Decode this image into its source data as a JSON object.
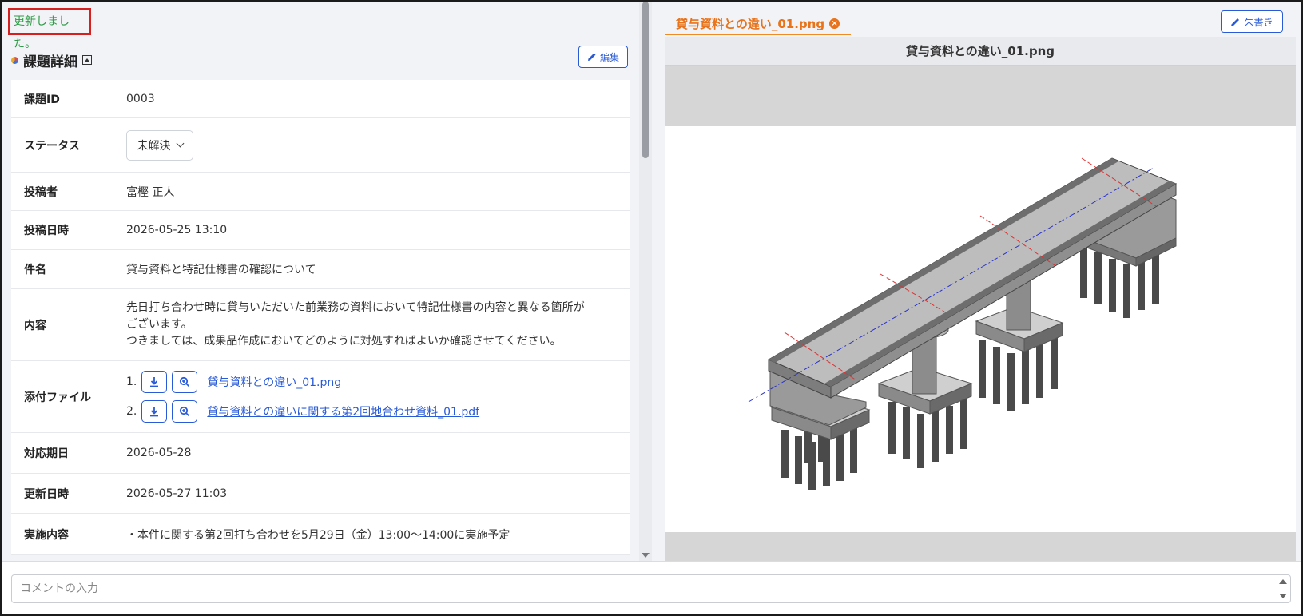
{
  "flash_message": "更新しました。",
  "section": {
    "title": "課題詳細",
    "edit_label": "編集"
  },
  "fields": {
    "issue_id": {
      "label": "課題ID",
      "value": "0003"
    },
    "status": {
      "label": "ステータス",
      "value": "未解決"
    },
    "poster": {
      "label": "投稿者",
      "value": "富樫 正人"
    },
    "posted_at": {
      "label": "投稿日時",
      "value": "2026-05-25 13:10"
    },
    "subject": {
      "label": "件名",
      "value": "貸与資料と特記仕様書の確認について"
    },
    "content": {
      "label": "内容",
      "lines": [
        "先日打ち合わせ時に貸与いただいた前業務の資料において特記仕様書の内容と異なる箇所が",
        "ございます。",
        "つきましては、成果品作成においてどのように対処すればよいか確認させてください。"
      ]
    },
    "attachments": {
      "label": "添付ファイル",
      "files": [
        {
          "num": "1.",
          "name": "貸与資料との違い_01.png"
        },
        {
          "num": "2.",
          "name": "貸与資料との違いに関する第2回地合わせ資料_01.pdf"
        }
      ]
    },
    "due_date": {
      "label": "対応期日",
      "value": "2026-05-28"
    },
    "updated_at": {
      "label": "更新日時",
      "value": "2026-05-27 11:03"
    },
    "action": {
      "label": "実施内容",
      "value": "・本件に関する第2回打ち合わせを5月29日（金）13:00～14:00に実施予定"
    }
  },
  "viewer": {
    "tab_label": "貸与資料との違い_01.png",
    "annotate_label": "朱書き",
    "image_title": "貸与資料との違い_01.png"
  },
  "comment": {
    "placeholder": "コメントの入力"
  },
  "colors": {
    "accent_blue": "#2a5bd7",
    "tab_orange": "#e8731a",
    "flash_green": "#2e9b46",
    "flash_border": "#d71f1f"
  }
}
